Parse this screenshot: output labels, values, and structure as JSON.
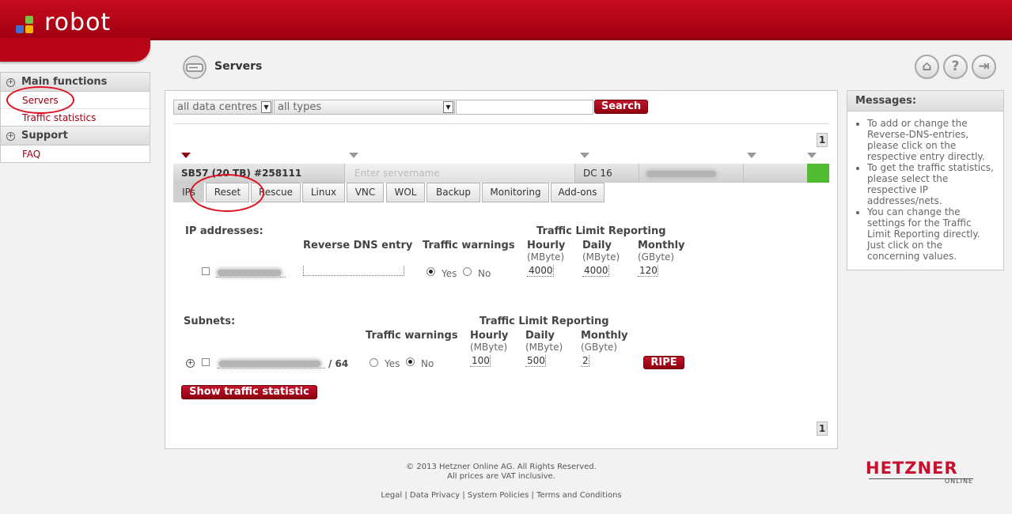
{
  "app": {
    "name": "robot"
  },
  "sidebar": {
    "sections": [
      {
        "title": "Main functions",
        "items": [
          "Servers",
          "Traffic statistics"
        ]
      },
      {
        "title": "Support",
        "items": [
          "FAQ"
        ]
      }
    ]
  },
  "page": {
    "title": "Servers"
  },
  "filters": {
    "datacentre": "all data centres",
    "type": "all types",
    "search_value": "",
    "search_label": "Search"
  },
  "pager": {
    "current": "1"
  },
  "server": {
    "name": "SB57 (20 TB) #258111",
    "name_placeholder": "Enter servername",
    "dc": "DC 16"
  },
  "tabs": [
    "IPs",
    "Reset",
    "Rescue",
    "Linux",
    "VNC",
    "WOL",
    "Backup",
    "Monitoring",
    "Add-ons"
  ],
  "ip_section": {
    "title": "IP addresses:",
    "rdns_header": "Reverse DNS entry",
    "tw_header": "Traffic warnings",
    "tlr_header": "Traffic Limit Reporting",
    "hourly": "Hourly",
    "hourly_unit": "(MByte)",
    "daily": "Daily",
    "daily_unit": "(MByte)",
    "monthly": "Monthly",
    "monthly_unit": "(GByte)",
    "yes": "Yes",
    "no": "No",
    "hourly_val": "4000",
    "daily_val": "4000",
    "monthly_val": "120"
  },
  "subnet_section": {
    "title": "Subnets:",
    "tw_header": "Traffic warnings",
    "tlr_header": "Traffic Limit Reporting",
    "hourly": "Hourly",
    "hourly_unit": "(MByte)",
    "daily": "Daily",
    "daily_unit": "(MByte)",
    "monthly": "Monthly",
    "monthly_unit": "(GByte)",
    "prefix": "/ 64",
    "yes": "Yes",
    "no": "No",
    "hourly_val": "100",
    "daily_val": "500",
    "monthly_val": "2",
    "ripe_label": "RIPE"
  },
  "traffic_btn": "Show traffic statistic",
  "messages": {
    "title": "Messages:",
    "items": [
      "To add or change the Reverse-DNS-entries, please click on the respective entry directly.",
      "To get the traffic statistics, please select the respective IP addresses/nets.",
      "You can change the settings for the Traffic Limit Reporting directly. Just click on the concerning values."
    ]
  },
  "footer": {
    "copyright": "© 2013 Hetzner Online AG. All Rights Reserved.",
    "vat": "All prices are VAT inclusive.",
    "links": [
      "Legal",
      "Data Privacy",
      "System Policies",
      "Terms and Conditions"
    ]
  },
  "brand": {
    "name": "HETZNER",
    "sub": "ONLINE"
  },
  "colors": {
    "brand_red": "#b3000f",
    "link_red": "#a00010",
    "status_green": "#4fbd2f"
  },
  "icons": [
    "home-icon",
    "help-icon",
    "logout-icon",
    "server-icon",
    "plus-circle-icon"
  ]
}
